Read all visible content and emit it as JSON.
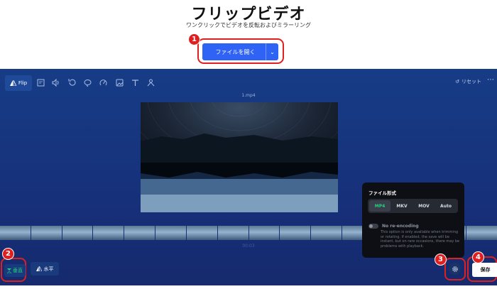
{
  "header": {
    "title": "フリップビデオ",
    "subtitle": "ワンクリックでビデオを反転およびミラーリング",
    "open_button": "ファイルを開く"
  },
  "callouts": [
    "1",
    "2",
    "3",
    "4"
  ],
  "accent_color": "#2e63f5",
  "callout_color": "#e02020",
  "toolbar": {
    "active_tool": "Flip",
    "tools": [
      "crop-icon",
      "volume-icon",
      "rotate-icon",
      "loop-icon",
      "speed-icon",
      "image-icon",
      "text-icon",
      "stabilize-icon"
    ],
    "reset_label": "リセット"
  },
  "video": {
    "filename": "1.mp4"
  },
  "timeline": {
    "duration": "00:03"
  },
  "flip": {
    "vertical_label": "垂直",
    "horizontal_label": "水平"
  },
  "format_popup": {
    "title": "ファイル形式",
    "formats": [
      "MP4",
      "MKV",
      "MOV",
      "Auto"
    ],
    "selected": "MP4",
    "reencode_label": "No re-encoding",
    "reencode_desc": "This option is only available when trimming or rotating. If enabled, the save will be instant, but on rare occasions, there may be problems with playback."
  },
  "save_label": "保存"
}
